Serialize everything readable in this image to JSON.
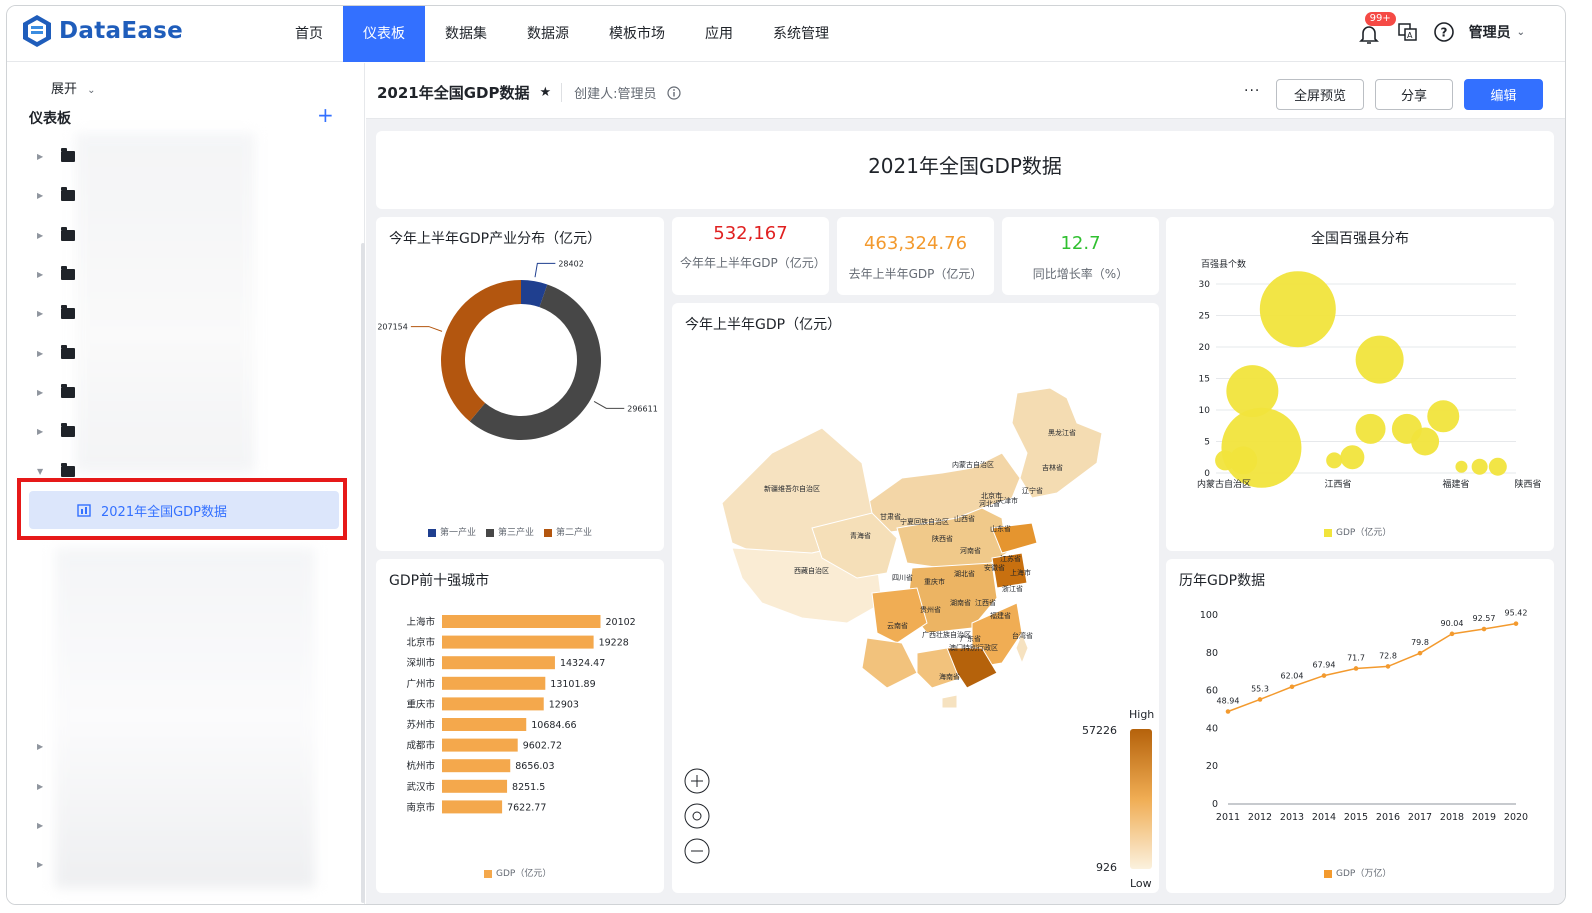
{
  "app": {
    "brand": "DataEase"
  },
  "nav": {
    "items": [
      "首页",
      "仪表板",
      "数据集",
      "数据源",
      "模板市场",
      "应用",
      "系统管理"
    ],
    "active_index": 1
  },
  "topbar": {
    "notification_badge": "99+",
    "user": "管理员"
  },
  "sidebar": {
    "expand_label": "展开",
    "section_title": "仪表板",
    "selected_item": "2021年全国GDP数据"
  },
  "dashboard": {
    "title": "2021年全国GDP数据",
    "creator": "创建人:管理员",
    "more_label": "···",
    "buttons": {
      "fullscreen": "全屏预览",
      "share": "分享",
      "edit": "编辑"
    },
    "banner_title": "2021年全国GDP数据"
  },
  "kpis": [
    {
      "value": "532,167",
      "label": "今年年上半年GDP（亿元）",
      "color": "#e02020"
    },
    {
      "value": "463,324.76",
      "label": "去年上半年GDP（亿元）",
      "color": "#f39a2e"
    },
    {
      "value": "12.7",
      "label": "同比增长率（%）",
      "color": "#30c030"
    }
  ],
  "donut": {
    "title": "今年上半年GDP产业分布（亿元）",
    "chart_data": {
      "type": "pie",
      "series": [
        {
          "name": "第一产业",
          "value": 28402,
          "color": "#1f3f8f"
        },
        {
          "name": "第三产业",
          "value": 296611,
          "color": "#474747"
        },
        {
          "name": "第二产业",
          "value": 207154,
          "color": "#b3560f"
        }
      ]
    }
  },
  "bars": {
    "title": "GDP前十强城市",
    "legend": "GDP（亿元）",
    "chart_data": {
      "type": "bar",
      "categories": [
        "上海市",
        "北京市",
        "深圳市",
        "广州市",
        "重庆市",
        "苏州市",
        "成都市",
        "杭州市",
        "武汉市",
        "南京市"
      ],
      "values": [
        20102,
        19228,
        14324.47,
        13101.89,
        12903,
        10684.66,
        9602.72,
        8656.03,
        8251.5,
        7622.77
      ],
      "labels": [
        "20102",
        "19228",
        "14324.47",
        "13101.89",
        "12903",
        "10684.66",
        "9602.72",
        "8656.03",
        "8251.5",
        "7622.77"
      ],
      "color": "#f4a84c"
    }
  },
  "map": {
    "title": "今年上半年GDP（亿元）",
    "scale_high_label": "High",
    "scale_low_label": "Low",
    "max_value": "57226",
    "min_value": "926",
    "provinces": [
      "黑龙江省",
      "吉林省",
      "辽宁省",
      "内蒙古自治区",
      "新疆维吾尔自治区",
      "北京市",
      "河北省",
      "天津市",
      "甘肃省",
      "宁夏回族自治区",
      "山西省",
      "山东省",
      "青海省",
      "陕西省",
      "河南省",
      "江苏省",
      "西藏自治区",
      "四川省",
      "湖北省",
      "安徽省",
      "上海市",
      "重庆市",
      "浙江省",
      "贵州省",
      "湖南省",
      "江西省",
      "福建省",
      "云南省",
      "广西壮族自治区",
      "广东省",
      "台湾省",
      "澳门特别行政区",
      "海南省"
    ]
  },
  "bubble": {
    "title": "全国百强县分布",
    "legend": "GDP（亿元）",
    "chart_data": {
      "type": "scatter",
      "ylabel": "百强县个数",
      "ylim": [
        0,
        30
      ],
      "yticks": [
        0,
        5,
        10,
        15,
        20,
        25,
        30
      ],
      "x_labels": [
        "内蒙古自治区",
        "江西省",
        "福建省",
        "陕西省"
      ],
      "points": [
        {
          "x": 1,
          "y": 2,
          "r": 10
        },
        {
          "x": 2,
          "y": 2,
          "r": 14
        },
        {
          "x": 2.5,
          "y": 13,
          "r": 26
        },
        {
          "x": 3,
          "y": 4,
          "r": 40
        },
        {
          "x": 5,
          "y": 26,
          "r": 38
        },
        {
          "x": 7,
          "y": 2,
          "r": 8
        },
        {
          "x": 8,
          "y": 2.5,
          "r": 12
        },
        {
          "x": 9,
          "y": 7,
          "r": 15
        },
        {
          "x": 9.5,
          "y": 18,
          "r": 24
        },
        {
          "x": 11,
          "y": 7,
          "r": 15
        },
        {
          "x": 12,
          "y": 5,
          "r": 14
        },
        {
          "x": 13,
          "y": 9,
          "r": 16
        },
        {
          "x": 14,
          "y": 1,
          "r": 6
        },
        {
          "x": 15,
          "y": 1,
          "r": 8
        },
        {
          "x": 16,
          "y": 1,
          "r": 9
        }
      ],
      "color": "#f1e43c"
    }
  },
  "line": {
    "title": "历年GDP数据",
    "legend": "GDP（万亿）",
    "chart_data": {
      "type": "line",
      "x": [
        "2011",
        "2012",
        "2013",
        "2014",
        "2015",
        "2016",
        "2017",
        "2018",
        "2019",
        "2020"
      ],
      "values": [
        48.94,
        55.3,
        62.04,
        67.94,
        71.7,
        72.8,
        79.8,
        90.04,
        92.57,
        95.42
      ],
      "labels": [
        "48.94",
        "55.3",
        "62.04",
        "67.94",
        "71.7",
        "72.8",
        "79.8",
        "90.04",
        "92.57",
        "95.42"
      ],
      "ylim": [
        0,
        100
      ],
      "yticks": [
        0,
        20,
        40,
        60,
        80,
        100
      ],
      "color": "#f39a2e"
    }
  }
}
